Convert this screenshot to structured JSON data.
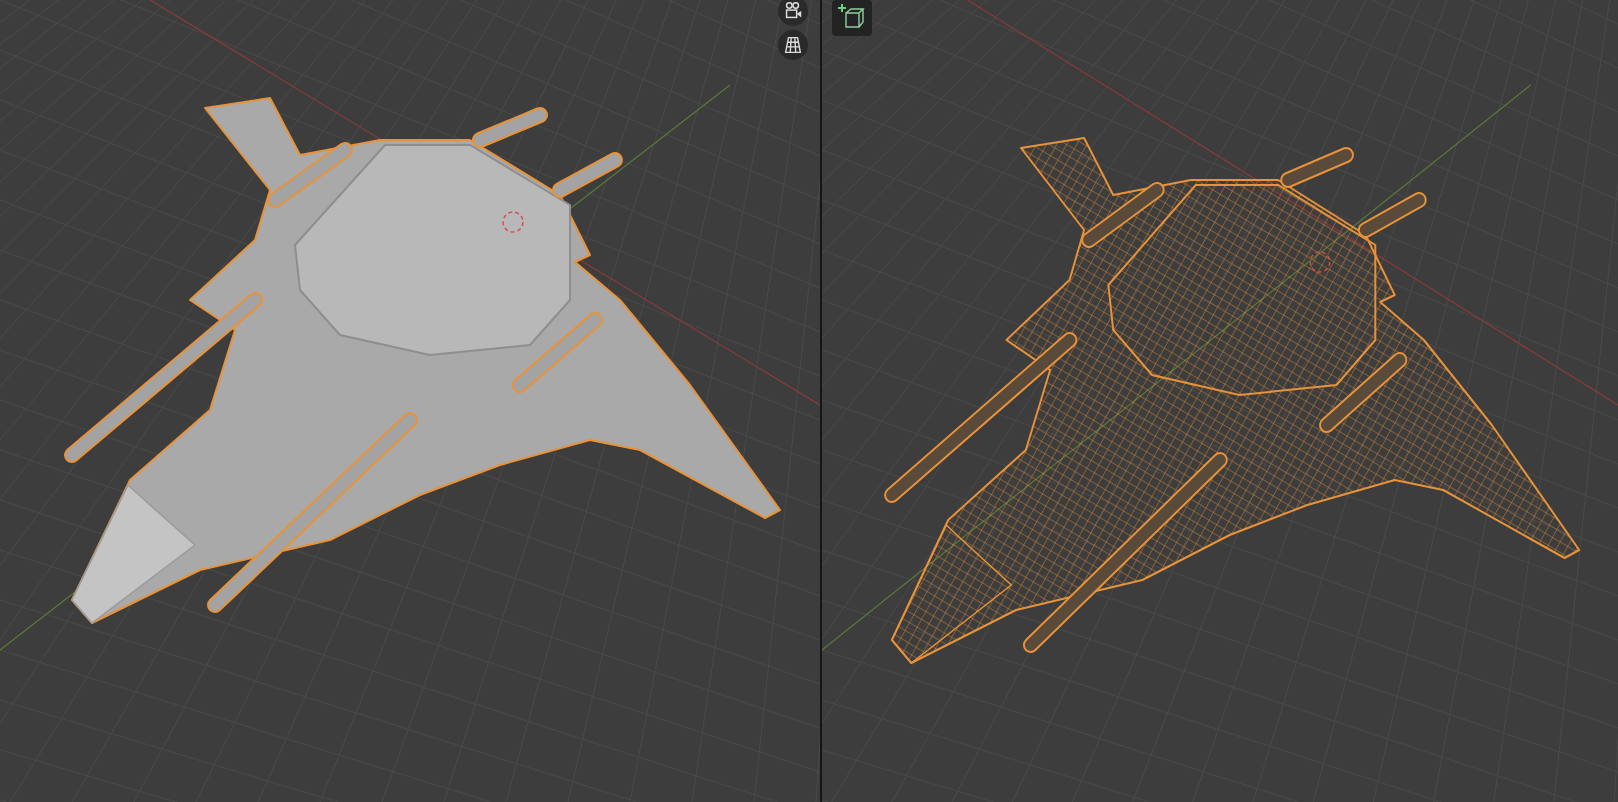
{
  "viewports": [
    {
      "kind": "solid"
    },
    {
      "kind": "wireframe"
    }
  ]
}
